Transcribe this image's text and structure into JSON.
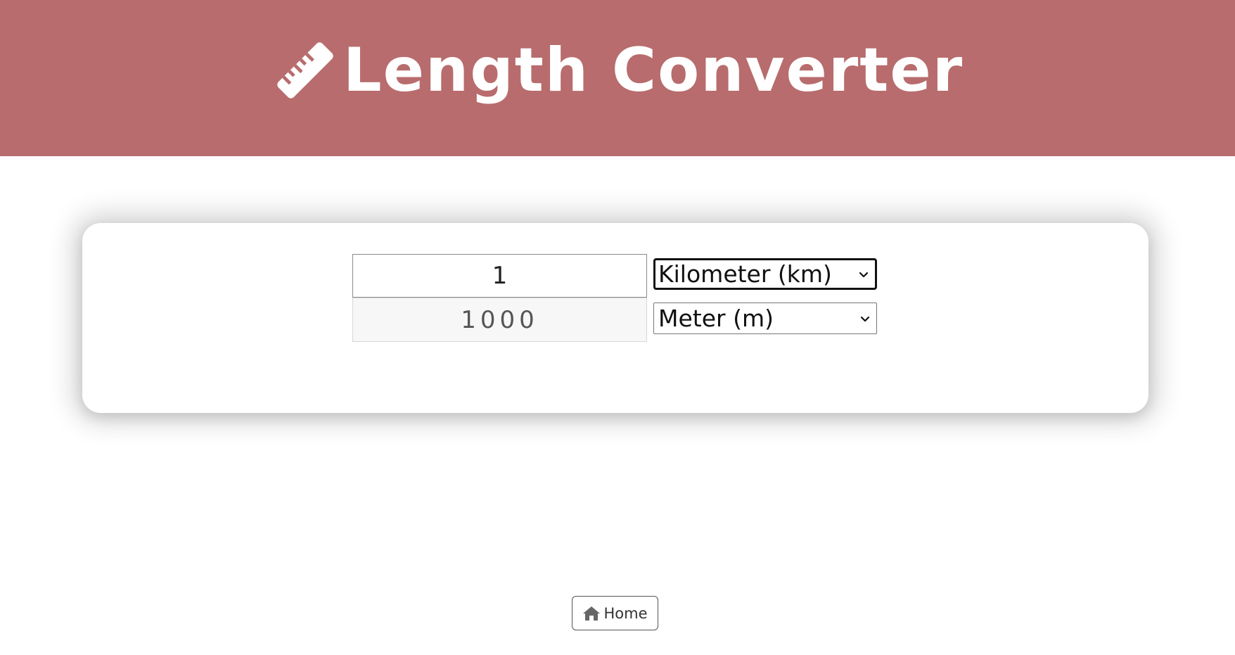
{
  "header": {
    "title": "Length Converter",
    "icon": "ruler-icon",
    "background_color": "#b86c6d"
  },
  "converter": {
    "input_value": "1",
    "result_value": "1000",
    "from_unit": {
      "selected": "Kilometer (km)",
      "icon": "chevron-down-icon"
    },
    "to_unit": {
      "selected": "Meter (m)",
      "icon": "chevron-down-icon"
    }
  },
  "footer": {
    "home_label": "Home",
    "home_icon": "home-icon"
  }
}
